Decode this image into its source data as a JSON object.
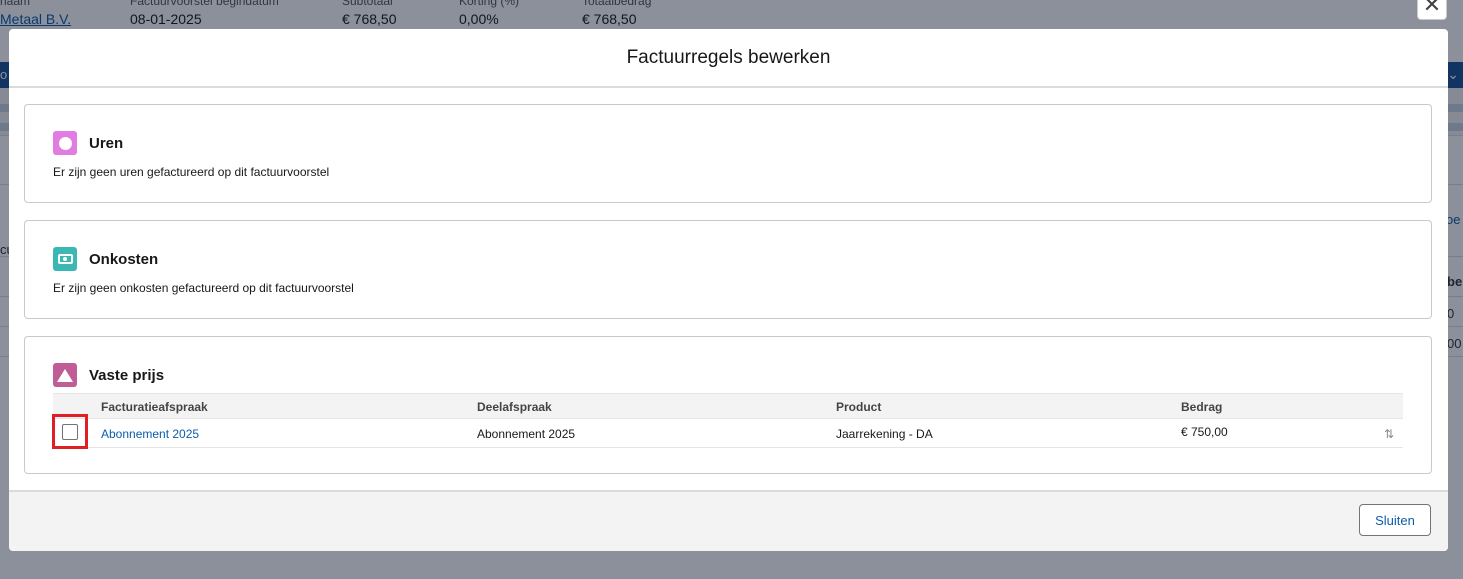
{
  "background": {
    "fields": [
      {
        "label": "naam",
        "value": "Metaal B.V."
      },
      {
        "label": "Factuurvoorstel begindatum",
        "value": "08-01-2025"
      },
      {
        "label": "Subtotaal",
        "value": "€ 768,50"
      },
      {
        "label": "Korting (%)",
        "value": "0,00%"
      },
      {
        "label": "Totaalbedrag",
        "value": "€ 768,50"
      }
    ],
    "edge_left_1": "o",
    "edge_left_2": "cu",
    "edge_right_1": "oe",
    "edge_right_2": "be",
    "edge_right_3": "0",
    "edge_right_4": "00"
  },
  "modal": {
    "title": "Factuurregels bewerken",
    "close_symbol": "✕",
    "sections": {
      "uren": {
        "title": "Uren",
        "text": "Er zijn geen uren gefactureerd op dit factuurvoorstel",
        "icon": "circle-icon",
        "color": "#e17ce0"
      },
      "onkosten": {
        "title": "Onkosten",
        "text": "Er zijn geen onkosten gefactureerd op dit factuurvoorstel",
        "icon": "money-icon",
        "color": "#3bb7b4"
      },
      "vaste_prijs": {
        "title": "Vaste prijs",
        "icon": "triangle-icon",
        "color": "#c05d97"
      }
    },
    "table": {
      "columns": [
        "Facturatieafspraak",
        "Deelafspraak",
        "Product",
        "Bedrag"
      ],
      "rows": [
        {
          "facturatieafspraak": "Abonnement 2025",
          "deelafspraak": "Abonnement 2025",
          "product": "Jaarrekening - DA",
          "bedrag": "€ 750,00",
          "checked": false
        }
      ],
      "sort_symbol": "⇅"
    },
    "footer": {
      "close_label": "Sluiten"
    }
  }
}
